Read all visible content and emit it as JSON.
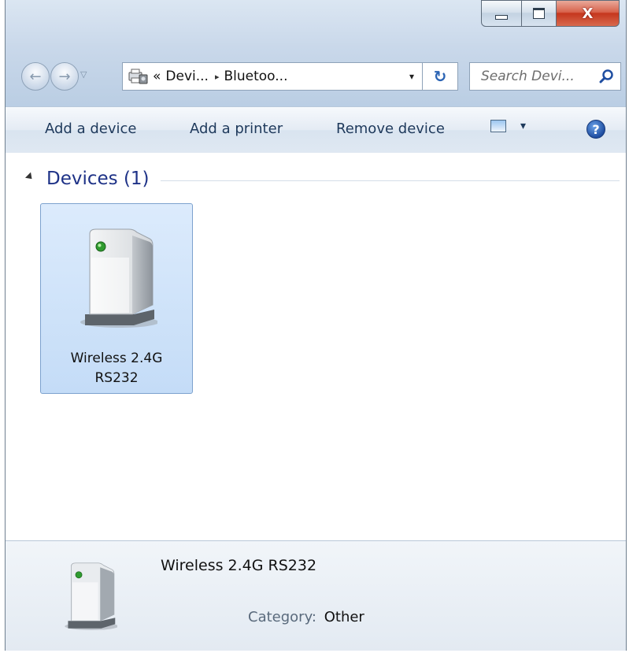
{
  "window": {
    "caption_buttons": {
      "minimize_icon": "minimize-icon",
      "maximize_icon": "maximize-icon",
      "close_glyph": "X"
    }
  },
  "nav": {
    "back_icon": "back-arrow-icon",
    "forward_icon": "forward-arrow-icon",
    "address": {
      "overflow_chevron": "«",
      "segment_1": "Devi...",
      "separator": "▸",
      "segment_2": "Bluetoo...",
      "dropdown_glyph": "▾"
    },
    "refresh_glyph": "↻",
    "search": {
      "placeholder": "Search Devi...",
      "icon": "search-icon"
    }
  },
  "commandbar": {
    "add_device": "Add a device",
    "add_printer": "Add a printer",
    "remove_device": "Remove device",
    "views_icon": "views-icon",
    "views_dropdown": "▾",
    "help_glyph": "?"
  },
  "content": {
    "group": {
      "title": "Devices (1)"
    },
    "devices": [
      {
        "line1": "Wireless 2.4G",
        "line2": "RS232",
        "icon": "device-icon",
        "selected": true
      }
    ]
  },
  "details": {
    "name": "Wireless 2.4G RS232",
    "category_label": "Category:",
    "category_value": "Other"
  },
  "colors": {
    "accent": "#1e3287",
    "selection": "#cfe3fb",
    "close_red": "#c5361e"
  }
}
